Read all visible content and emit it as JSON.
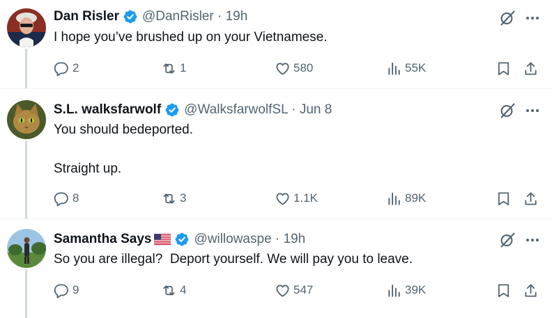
{
  "tweets": [
    {
      "name": "Dan Risler",
      "handle": "@DanRisler",
      "time": "19h",
      "text": "I hope you’ve brushed up on your Vietnamese.",
      "replies": "2",
      "retweets": "1",
      "likes": "580",
      "views": "55K",
      "verified": true,
      "flag": ""
    },
    {
      "name": "S.L. walksfarwolf",
      "handle": "@WalksfarwolfSL",
      "time": "Jun 8",
      "text": "You should bedeported.\n\nStraight up.",
      "replies": "8",
      "retweets": "3",
      "likes": "1.1K",
      "views": "89K",
      "verified": true,
      "flag": ""
    },
    {
      "name": "Samantha Says",
      "handle": "@willowaspe",
      "time": "19h",
      "text": "So you are illegal?  Deport yourself. We will pay you to leave.",
      "replies": "9",
      "retweets": "4",
      "likes": "547",
      "views": "39K",
      "verified": true,
      "flag": "us-flag"
    }
  ],
  "separator": "·",
  "colors": {
    "text": "#0f1419",
    "secondary": "#536471",
    "verified_blue": "#1d9bf0",
    "thread_line": "#cfd9de",
    "divider": "#eff3f4"
  },
  "icons": {
    "reply": "reply-icon",
    "retweet": "retweet-icon",
    "like": "heart-icon",
    "views": "views-icon",
    "bookmark": "bookmark-icon",
    "share": "share-icon",
    "grok": "grok-icon",
    "more": "more-icon"
  }
}
